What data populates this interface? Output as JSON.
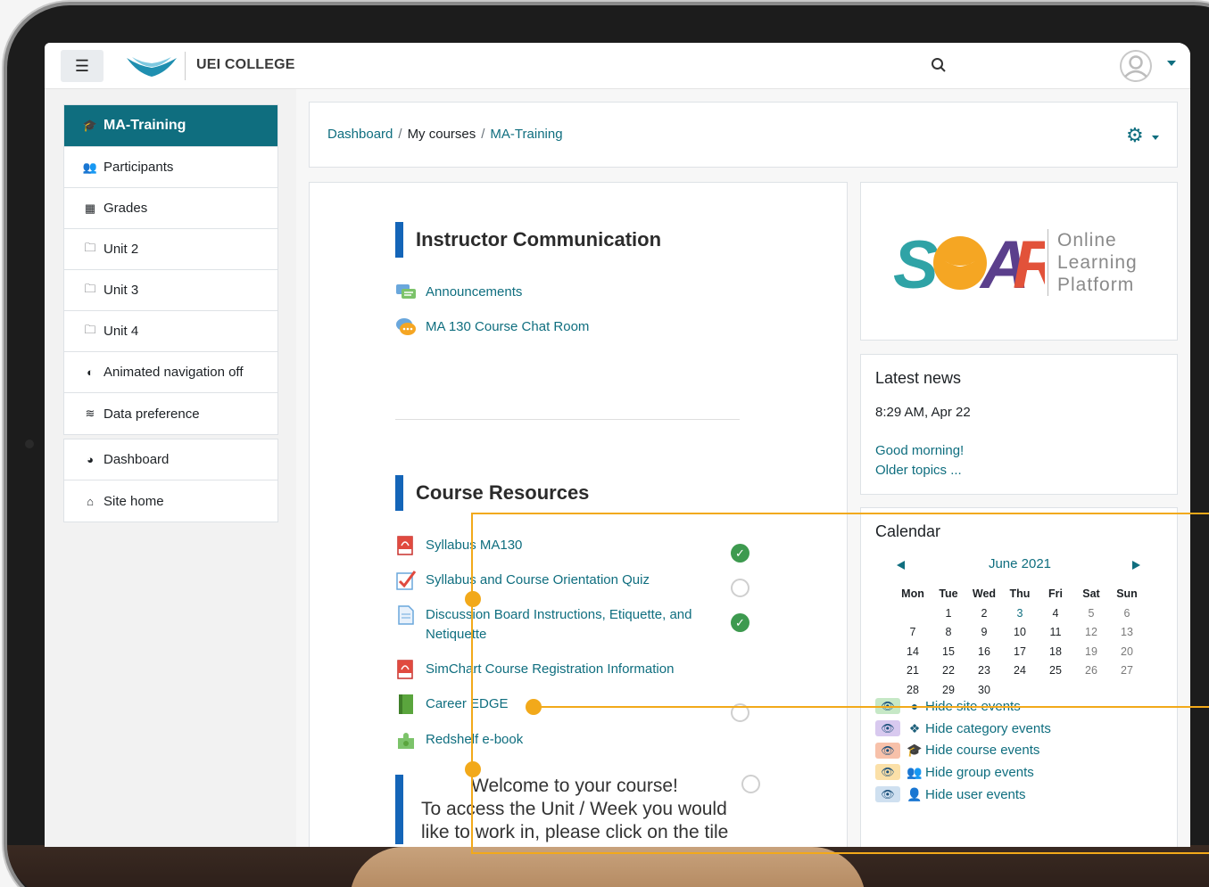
{
  "topbar": {
    "brand": "UEI COLLEGE",
    "menu_icon": "hamburger-icon",
    "search_icon": "search-icon",
    "user_icon": "user-avatar-icon"
  },
  "nav": {
    "course_items": [
      {
        "label": "MA-Training",
        "icon": "graduation-cap-icon",
        "active": true
      },
      {
        "label": "Participants",
        "icon": "users-icon"
      },
      {
        "label": "Grades",
        "icon": "table-icon"
      },
      {
        "label": "Unit 2",
        "icon": "folder-icon"
      },
      {
        "label": "Unit 3",
        "icon": "folder-icon"
      },
      {
        "label": "Unit 4",
        "icon": "folder-icon"
      },
      {
        "label": "Animated navigation off",
        "icon": "toggle-icon"
      },
      {
        "label": "Data preference",
        "icon": "database-icon"
      }
    ],
    "site_items": [
      {
        "label": "Dashboard",
        "icon": "tachometer-icon"
      },
      {
        "label": "Site home",
        "icon": "home-icon"
      }
    ]
  },
  "breadcrumb": {
    "items": [
      "Dashboard",
      "My courses",
      "MA-Training"
    ],
    "separator": "/"
  },
  "course": {
    "section1": {
      "title": "Instructor Communication",
      "activities": [
        {
          "label": "Announcements",
          "icon": "forum-icon"
        },
        {
          "label": "MA 130 Course Chat Room",
          "icon": "chat-icon"
        }
      ]
    },
    "section2": {
      "title": "Course Resources",
      "activities": [
        {
          "label": "Syllabus MA130",
          "icon": "pdf-icon",
          "status": "complete"
        },
        {
          "label": "Syllabus and Course Orientation Quiz",
          "icon": "quiz-icon",
          "status": "incomplete"
        },
        {
          "label": "Discussion Board Instructions, Etiquette, and Netiquette",
          "icon": "page-icon",
          "status": "complete"
        },
        {
          "label": "SimChart Course Registration Information",
          "icon": "pdf-icon",
          "status": "none"
        },
        {
          "label": "Career EDGE",
          "icon": "book-icon",
          "status": "incomplete"
        },
        {
          "label": "Redshelf e-book",
          "icon": "lti-puzzle-icon",
          "status": "none"
        }
      ]
    },
    "welcome": {
      "line1": "Welcome to your course!",
      "line2": "To access the Unit / Week you would",
      "line3": "like to work in, please click on the tile"
    }
  },
  "soar": {
    "logo_text": "SOAR",
    "tag1": "Online",
    "tag2": "Learning",
    "tag3": "Platform",
    "colors": {
      "teal": "#2fa3a6",
      "orange": "#f5a623",
      "purple": "#5b3f8c",
      "red": "#e2523a"
    }
  },
  "news": {
    "title": "Latest news",
    "date": "8:29 AM, Apr 22",
    "post": "Good morning!",
    "older": "Older topics ..."
  },
  "calendar": {
    "title": "Calendar",
    "month": "June 2021",
    "days": [
      "Mon",
      "Tue",
      "Wed",
      "Thu",
      "Fri",
      "Sat",
      "Sun"
    ],
    "weeks": [
      [
        "",
        "1",
        "2",
        "3",
        "4",
        "5",
        "6"
      ],
      [
        "7",
        "8",
        "9",
        "10",
        "11",
        "12",
        "13"
      ],
      [
        "14",
        "15",
        "16",
        "17",
        "18",
        "19",
        "20"
      ],
      [
        "21",
        "22",
        "23",
        "24",
        "25",
        "26",
        "27"
      ],
      [
        "28",
        "29",
        "30",
        "",
        "",
        "",
        ""
      ]
    ],
    "today": "3",
    "legend": [
      {
        "label": "Hide site events",
        "icon": "globe-icon",
        "color": "#c6e8c6"
      },
      {
        "label": "Hide category events",
        "icon": "cubes-icon",
        "color": "#d8c9ef"
      },
      {
        "label": "Hide course events",
        "icon": "graduation-cap-icon",
        "color": "#f7c1aa"
      },
      {
        "label": "Hide group events",
        "icon": "users-icon",
        "color": "#fbe0a8"
      },
      {
        "label": "Hide user events",
        "icon": "user-icon",
        "color": "#cfe0f0"
      }
    ]
  },
  "colors": {
    "primary": "#0f6e7f",
    "section_bar": "#1465b8",
    "callout": "#f2a91a",
    "complete": "#3d9a4f"
  }
}
